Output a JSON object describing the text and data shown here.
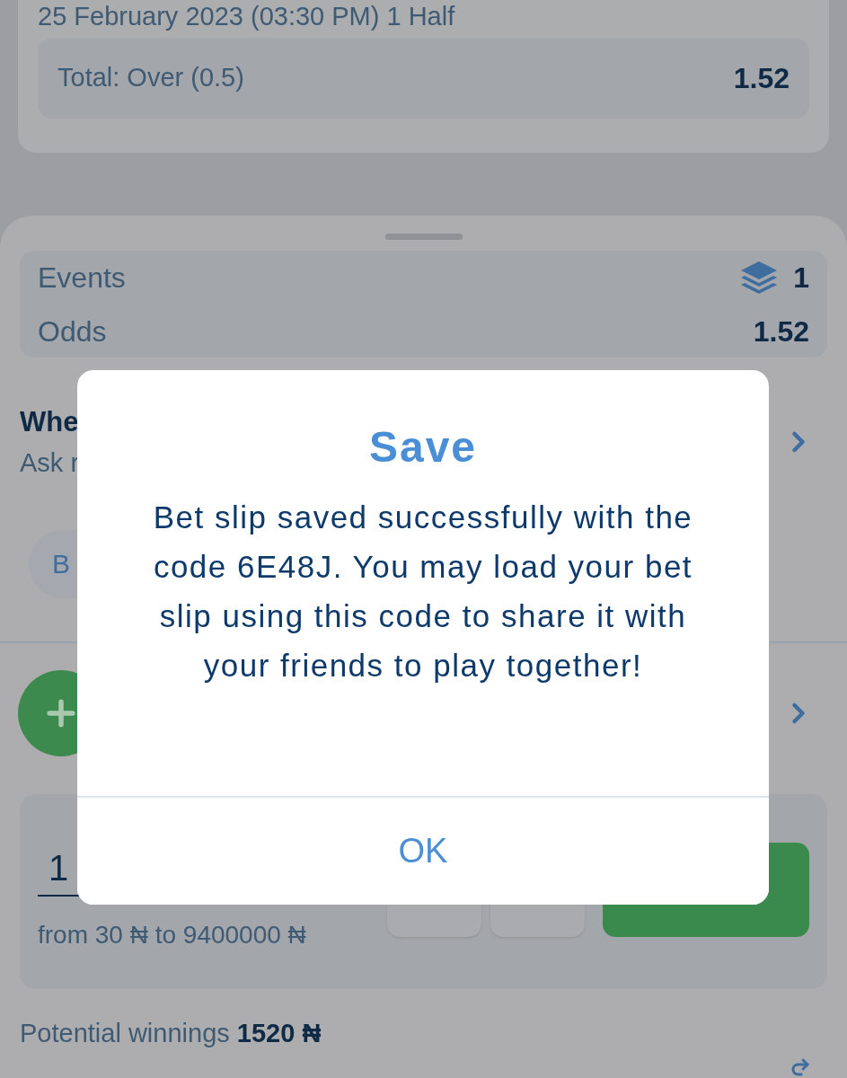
{
  "event_card": {
    "date": "25 February 2023 (03:30 PM) 1 Half",
    "bet": {
      "label": "Total: Over (0.5)",
      "odds": "1.52"
    }
  },
  "summary": {
    "events_label": "Events",
    "events_count": "1",
    "odds_label": "Odds",
    "odds_value": "1.52"
  },
  "option_row": {
    "title": "Whe",
    "subtitle": "Ask r"
  },
  "pill_button": "B",
  "stake": {
    "value": "1",
    "range": "from 30 ₦ to 9400000 ₦"
  },
  "potential_winnings": {
    "label": "Potential winnings",
    "value": "1520 ₦"
  },
  "dialog": {
    "title": "Save",
    "message": "Bet slip saved successfully with the code 6E48J. You may load your bet slip using this code to share it with your friends to play together!",
    "button": "OK"
  }
}
